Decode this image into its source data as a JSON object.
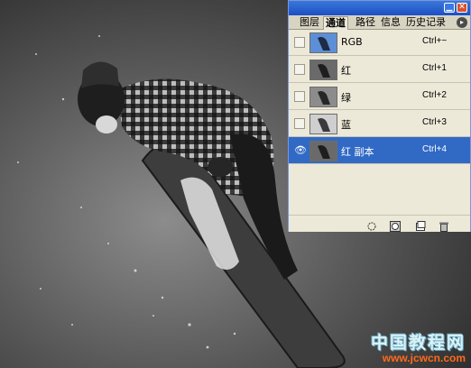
{
  "panel": {
    "tabs": [
      "图层",
      "通道",
      "路径",
      "信息",
      "历史记录"
    ],
    "active_tab": "通道",
    "channels": [
      {
        "name": "RGB",
        "shortcut": "Ctrl+~",
        "visible": false,
        "selected": false
      },
      {
        "name": "红",
        "shortcut": "Ctrl+1",
        "visible": false,
        "selected": false
      },
      {
        "name": "绿",
        "shortcut": "Ctrl+2",
        "visible": false,
        "selected": false
      },
      {
        "name": "蓝",
        "shortcut": "Ctrl+3",
        "visible": false,
        "selected": false
      },
      {
        "name": "红 副本",
        "shortcut": "Ctrl+4",
        "visible": true,
        "selected": true
      }
    ],
    "minimize_glyph": "▁",
    "close_glyph": "✕",
    "menu_glyph": "▸",
    "eye_glyph": "👁",
    "bottom_icons": [
      "load-selection-icon",
      "save-selection-icon",
      "new-channel-icon",
      "trash-icon"
    ]
  },
  "watermark": {
    "title": "中国教程网",
    "url": "www.jcwcn.com"
  },
  "colors": {
    "selection": "#316ac5",
    "titlebar": "#1c4fc4",
    "watermark_url": "#ff6a1a"
  }
}
